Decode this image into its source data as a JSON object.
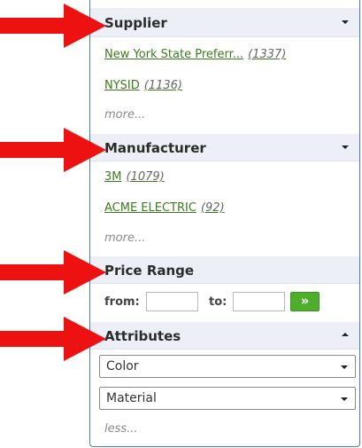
{
  "supplier": {
    "title": "Supplier",
    "items": [
      {
        "label": "New York State Preferr...",
        "count": "(1337)"
      },
      {
        "label": "NYSID",
        "count": "(1136)"
      }
    ],
    "more": "more..."
  },
  "manufacturer": {
    "title": "Manufacturer",
    "items": [
      {
        "label": "3M",
        "count": "(1079)"
      },
      {
        "label": "ACME ELECTRIC",
        "count": "(92)"
      }
    ],
    "more": "more..."
  },
  "price_range": {
    "title": "Price Range",
    "from_label": "from:",
    "to_label": "to:",
    "from_value": "",
    "to_value": "",
    "go_label": "»"
  },
  "attributes": {
    "title": "Attributes",
    "selects": [
      "Color",
      "Material"
    ],
    "less": "less..."
  },
  "colors": {
    "arrow": "#ee1111",
    "link": "#3d7a1e",
    "header_bg": "#eceff5",
    "go_button": "#4cae2b",
    "panel_border": "#4a78b6"
  }
}
